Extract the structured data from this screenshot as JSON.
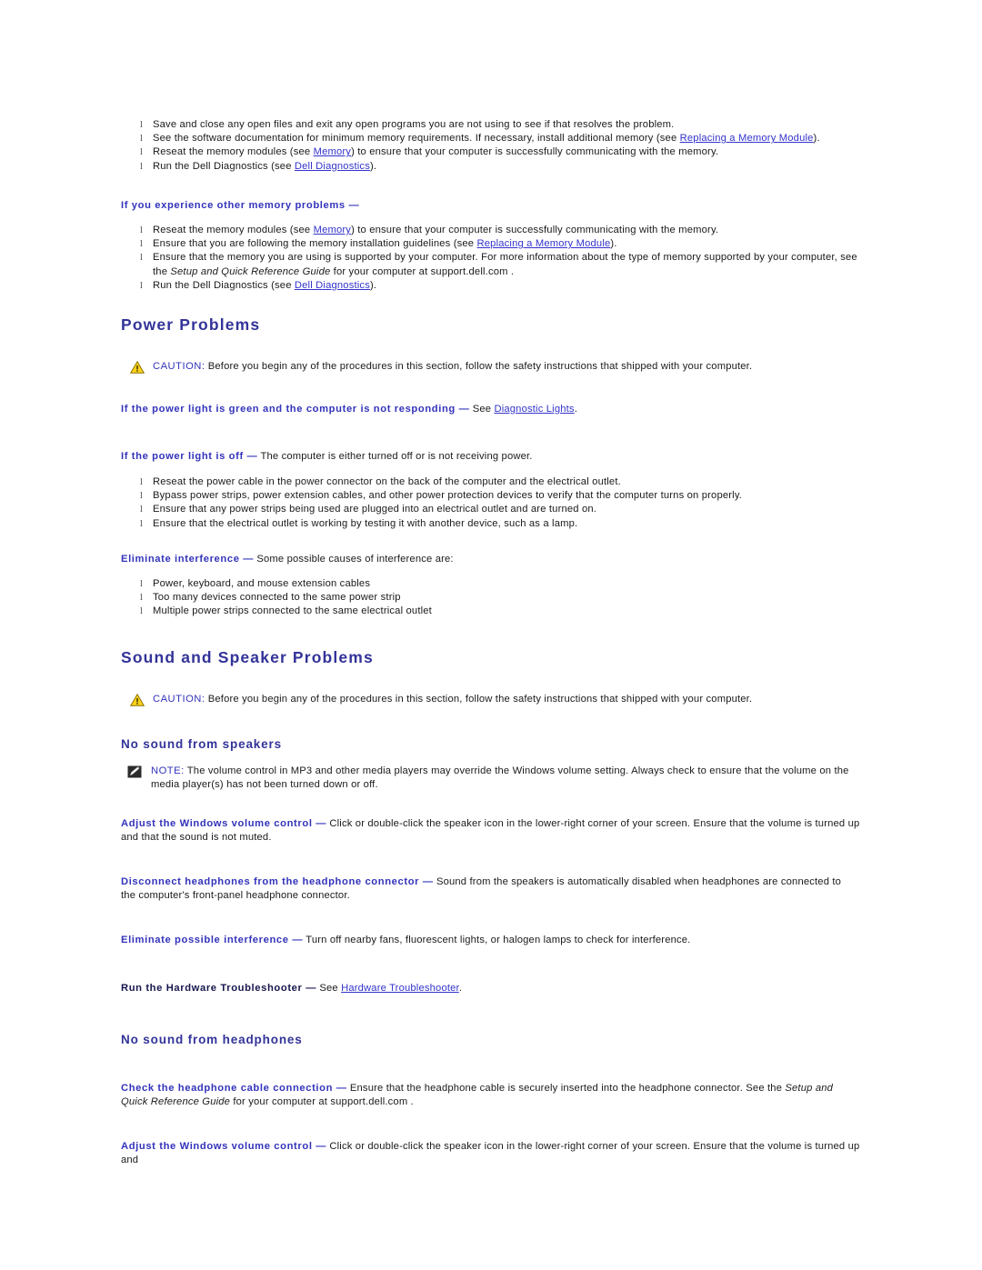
{
  "document": {
    "memory_list": [
      {
        "segments": [
          {
            "text": "Save and close any open files and exit any open programs you are not using to see if that resolves the problem.",
            "type": "plain"
          }
        ]
      },
      {
        "segments": [
          {
            "text": "See the software documentation for minimum memory requirements. If necessary, install additional memory (see ",
            "type": "plain"
          },
          {
            "text": "Replacing a Memory Module",
            "type": "link"
          },
          {
            "text": ").",
            "type": "plain"
          }
        ]
      },
      {
        "segments": [
          {
            "text": "Reseat the memory modules (see ",
            "type": "plain"
          },
          {
            "text": "Memory",
            "type": "link"
          },
          {
            "text": ") to ensure that your computer is successfully communicating with the memory.",
            "type": "plain"
          }
        ]
      },
      {
        "segments": [
          {
            "text": "Run the Dell Diagnostics (see ",
            "type": "plain"
          },
          {
            "text": "Dell Diagnostics",
            "type": "link"
          },
          {
            "text": ").",
            "type": "plain"
          }
        ]
      }
    ],
    "other_memory_heading": "If you experience other memory problems —",
    "other_memory_list": [
      {
        "segments": [
          {
            "text": "Reseat the memory modules (see ",
            "type": "plain"
          },
          {
            "text": "Memory",
            "type": "link"
          },
          {
            "text": ") to ensure that your computer is successfully communicating with the memory.",
            "type": "plain"
          }
        ]
      },
      {
        "segments": [
          {
            "text": "Ensure that you are following the memory installation guidelines (see ",
            "type": "plain"
          },
          {
            "text": "Replacing a Memory Module",
            "type": "link"
          },
          {
            "text": ").",
            "type": "plain"
          }
        ]
      },
      {
        "segments": [
          {
            "text": "Ensure that the memory you are using is supported by your computer. For more information about the type of memory supported by your computer, see the ",
            "type": "plain"
          },
          {
            "text": "Setup and Quick Reference Guide",
            "type": "italic"
          },
          {
            "text": " for your computer at support.dell.com .",
            "type": "plain"
          }
        ]
      },
      {
        "segments": [
          {
            "text": "Run the Dell Diagnostics (see ",
            "type": "plain"
          },
          {
            "text": "Dell Diagnostics",
            "type": "link"
          },
          {
            "text": ").",
            "type": "plain"
          }
        ]
      }
    ],
    "power_problems": {
      "title": "Power Problems",
      "caution": {
        "label": "CAUTION:",
        "text": " Before you begin any of the procedures in this section, follow the safety instructions that shipped with your computer."
      },
      "green_light": {
        "lead": "If the power light is green and the computer is not responding —",
        "segments": [
          {
            "text": " See ",
            "type": "plain"
          },
          {
            "text": "Diagnostic Lights",
            "type": "link"
          },
          {
            "text": ".",
            "type": "plain"
          }
        ]
      },
      "light_off": {
        "lead": "If the power light is off —",
        "rest": " The computer is either turned off or is not receiving power.",
        "items": [
          "Reseat the power cable in the power connector on the back of the computer and the electrical outlet.",
          "Bypass power strips, power extension cables, and other power protection devices to verify that the computer turns on properly.",
          "Ensure that any power strips being used are plugged into an electrical outlet and are turned on.",
          "Ensure that the electrical outlet is working by testing it with another device, such as a lamp."
        ]
      },
      "interference": {
        "lead": "Eliminate interference —",
        "rest": " Some possible causes of interference are:",
        "items": [
          "Power, keyboard, and mouse extension cables",
          "Too many devices connected to the same power strip",
          "Multiple power strips connected to the same electrical outlet"
        ]
      }
    },
    "sound_problems": {
      "title": "Sound and Speaker Problems",
      "caution": {
        "label": "CAUTION:",
        "text": " Before you begin any of the procedures in this section, follow the safety instructions that shipped with your computer."
      },
      "no_sound_speakers": {
        "title": "No sound from speakers",
        "note": {
          "label": "NOTE:",
          "text": " The volume control in MP3 and other media players may override the Windows volume setting. Always check to ensure that the volume on the media player(s) has not been turned down or off."
        },
        "volume_control": {
          "lead": "Adjust the Windows volume control —",
          "rest": " Click or double-click the speaker icon in the lower-right corner of your screen. Ensure that the volume is turned up and that the sound is not muted."
        },
        "headphones": {
          "lead": "Disconnect headphones from the headphone connector —",
          "rest": " Sound from the speakers is automatically disabled when headphones are connected to the computer's front-panel headphone connector."
        },
        "interference": {
          "lead": "Eliminate possible interference —",
          "rest": " Turn off nearby fans, fluorescent lights, or halogen lamps to check for interference."
        },
        "troubleshooter": {
          "lead": "Run the Hardware Troubleshooter —",
          "segments": [
            {
              "text": " See ",
              "type": "plain"
            },
            {
              "text": "Hardware Troubleshooter",
              "type": "link"
            },
            {
              "text": ".",
              "type": "plain"
            }
          ]
        }
      },
      "no_sound_headphones": {
        "title": "No sound from headphones",
        "cable_check": {
          "lead": "Check the headphone cable connection —",
          "segments": [
            {
              "text": " Ensure that the headphone cable is securely inserted into the headphone connector. See the ",
              "type": "plain"
            },
            {
              "text": "Setup and Quick Reference Guide",
              "type": "italic"
            },
            {
              "text": " for your computer at support.dell.com .",
              "type": "plain"
            }
          ]
        },
        "volume_control": {
          "lead": "Adjust the Windows volume control —",
          "rest": " Click or double-click the speaker icon in the lower-right corner of your screen. Ensure that the volume is turned up and"
        }
      }
    },
    "colors": {
      "heading": "#333399",
      "lead_in": "#3333bb",
      "link": "#3333cc",
      "body": "#1a1a1a",
      "caution_icon": "#ffcc00",
      "background": "#ffffff"
    }
  }
}
